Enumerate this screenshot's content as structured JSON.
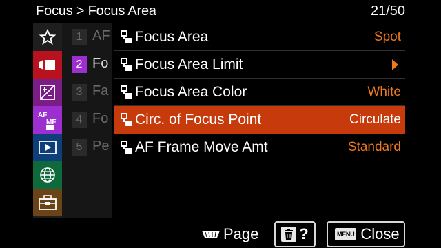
{
  "header": {
    "breadcrumb": "Focus > Focus Area",
    "page_counter": "21/50"
  },
  "sidebar": {
    "selected_index": 3,
    "items": [
      {
        "icon": "star-icon"
      },
      {
        "icon": "movie-camera-icon"
      },
      {
        "icon": "exposure-icon"
      },
      {
        "icon": "af-mf-icon",
        "label_top": "AF",
        "label_bottom": "MF"
      },
      {
        "icon": "playback-icon"
      },
      {
        "icon": "network-globe-icon"
      },
      {
        "icon": "toolbox-icon"
      }
    ]
  },
  "submenu": {
    "items": [
      {
        "number": "1",
        "text": "AF",
        "active": false
      },
      {
        "number": "2",
        "text": "Fo",
        "active": true
      },
      {
        "number": "3",
        "text": "Fa",
        "active": false
      },
      {
        "number": "4",
        "text": "Fo",
        "active": false
      },
      {
        "number": "5",
        "text": "Pe",
        "active": false
      }
    ]
  },
  "menu": {
    "selected_index": 3,
    "items": [
      {
        "label": "Focus Area",
        "value": "Spot"
      },
      {
        "label": "Focus Area Limit",
        "value": ""
      },
      {
        "label": "Focus Area Color",
        "value": "White"
      },
      {
        "label": "Circ. of Focus Point",
        "value": "Circulate"
      },
      {
        "label": "AF Frame Move Amt",
        "value": "Standard"
      }
    ]
  },
  "footer": {
    "page_label": "Page",
    "help_label": "?",
    "menu_key_label": "MENU",
    "close_label": "Close"
  },
  "colors": {
    "selection": "#c73a0b",
    "value_text": "#ee7a1c",
    "submenu_active": "#9d2fd0",
    "sidebar_tabs": [
      "#1e1e1e",
      "#b8121e",
      "#7a1d86",
      "#9d2fd0",
      "#0f3f7a",
      "#0e6a3a",
      "#6a4316"
    ]
  }
}
